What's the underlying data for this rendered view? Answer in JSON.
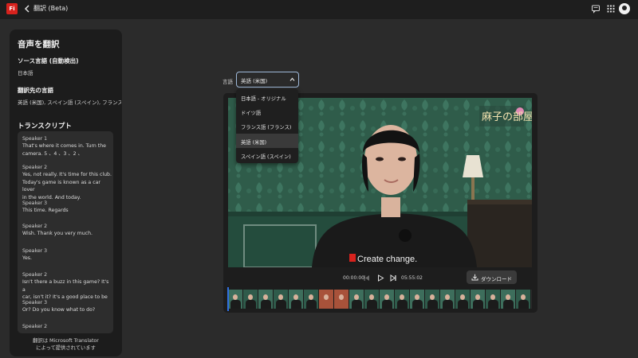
{
  "header": {
    "app_logo": "Fi",
    "title": "翻訳 (Beta)",
    "icons": [
      "back-chevron-icon",
      "chat-icon",
      "apps-grid-icon",
      "user-avatar"
    ]
  },
  "sidebar": {
    "title": "音声を翻訳",
    "source_label": "ソース言語 (自動検出)",
    "source_value": "日本語",
    "target_label": "翻訳先の言語",
    "target_value": "英語 (米国), スペイン語 (スペイン), フランス…",
    "transcript_title": "トランスクリプト",
    "transcript": [
      {
        "speaker": "Speaker 1",
        "lines": [
          "That's where it comes in. Turn the",
          "camera. 5 、4 、3 、2 、"
        ]
      },
      {
        "speaker": "Speaker 2",
        "lines": [
          "Yes, not really. It's time for this club.",
          "Today's game is known as a car lover",
          "in the world. And today."
        ]
      },
      {
        "speaker": "Speaker 3",
        "lines": [
          "This time. Regards"
        ]
      },
      {
        "speaker": "Speaker 2",
        "lines": [
          "Wish. Thank you very much."
        ]
      },
      {
        "speaker": "Speaker 3",
        "lines": [
          "Yes."
        ]
      },
      {
        "speaker": "Speaker 2",
        "lines": [
          "Isn't there a buzz in this game? It's a",
          "car, isn't it? It's a good place to be"
        ]
      },
      {
        "speaker": "Speaker 3",
        "lines": [
          "Or? Do you know what to do?"
        ]
      },
      {
        "speaker": "Speaker 2",
        "lines": []
      }
    ],
    "footer_line1": "翻訳は Microsoft Translator",
    "footer_line2": "によって提供されています"
  },
  "language": {
    "label": "言語",
    "selected": "英語 (米国)",
    "options": [
      "日本語 - オリジナル",
      "ドイツ語",
      "フランス語 (フランス)",
      "英語 (米国)",
      "スペイン語 (スペイン)"
    ],
    "selected_index": 3
  },
  "video": {
    "overlay_title": "麻子の部屋",
    "shirt_text": "Create change.",
    "current_time": "00:00:00",
    "duration": "05:55:02",
    "download_label": "ダウンロード"
  },
  "colors": {
    "accent_brand": "#d7221d",
    "playhead": "#2f6fe0",
    "select_border": "#9fb9d9"
  }
}
